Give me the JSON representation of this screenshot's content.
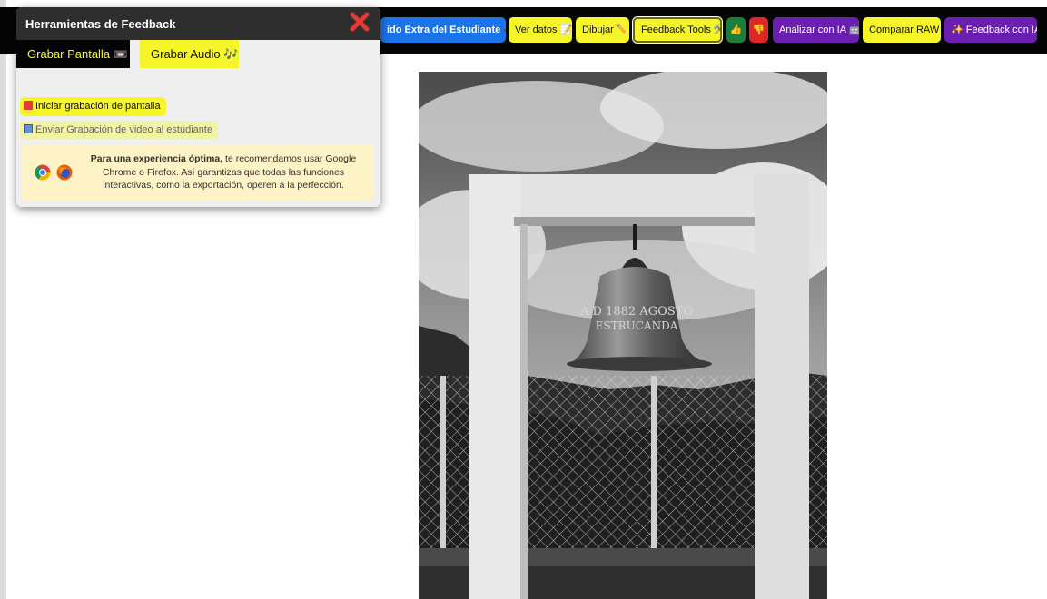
{
  "toolbar": {
    "extra_content_label": "ido Extra del Estudiante 📹",
    "ver_datos_label": "Ver datos 📝",
    "dibujar_label": "Dibujar ✏️",
    "feedback_tools_label": "Feedback Tools 🛠️",
    "thumbs_up_label": "👍",
    "thumbs_down_label": "👎",
    "analizar_ia_label": "Analizar con IA 🤖",
    "comparar_raw_label": "Comparar RAW",
    "feedback_ia_label": "✨ Feedback con IA"
  },
  "panel": {
    "title": "Herramientas de Feedback",
    "tabs": [
      {
        "label": "Grabar Pantalla 📼",
        "active": true
      },
      {
        "label": "Grabar Audio 🎶",
        "active": false
      }
    ],
    "start_recording_label": "Iniciar grabación de pantalla",
    "send_recording_label": "Enviar Grabación de video al estudiante",
    "notice": {
      "bold": "Para una experiencia óptima,",
      "text": " te recomendamos usar Google Chrome o Firefox. Así garantizas que todas las funciones interactivas, como la exportación, operen a la perfección."
    },
    "icons": [
      "close-icon",
      "stop-square-icon",
      "floppy-disk-icon",
      "chrome-icon",
      "firefox-icon"
    ]
  },
  "colors": {
    "topbar": "#050505",
    "accent_yellow": "#f5f52a",
    "blue": "#1a73e8",
    "purple": "#6a1fb0",
    "green": "#1b7f3b",
    "red": "#e02727",
    "close_red": "#e53935"
  }
}
